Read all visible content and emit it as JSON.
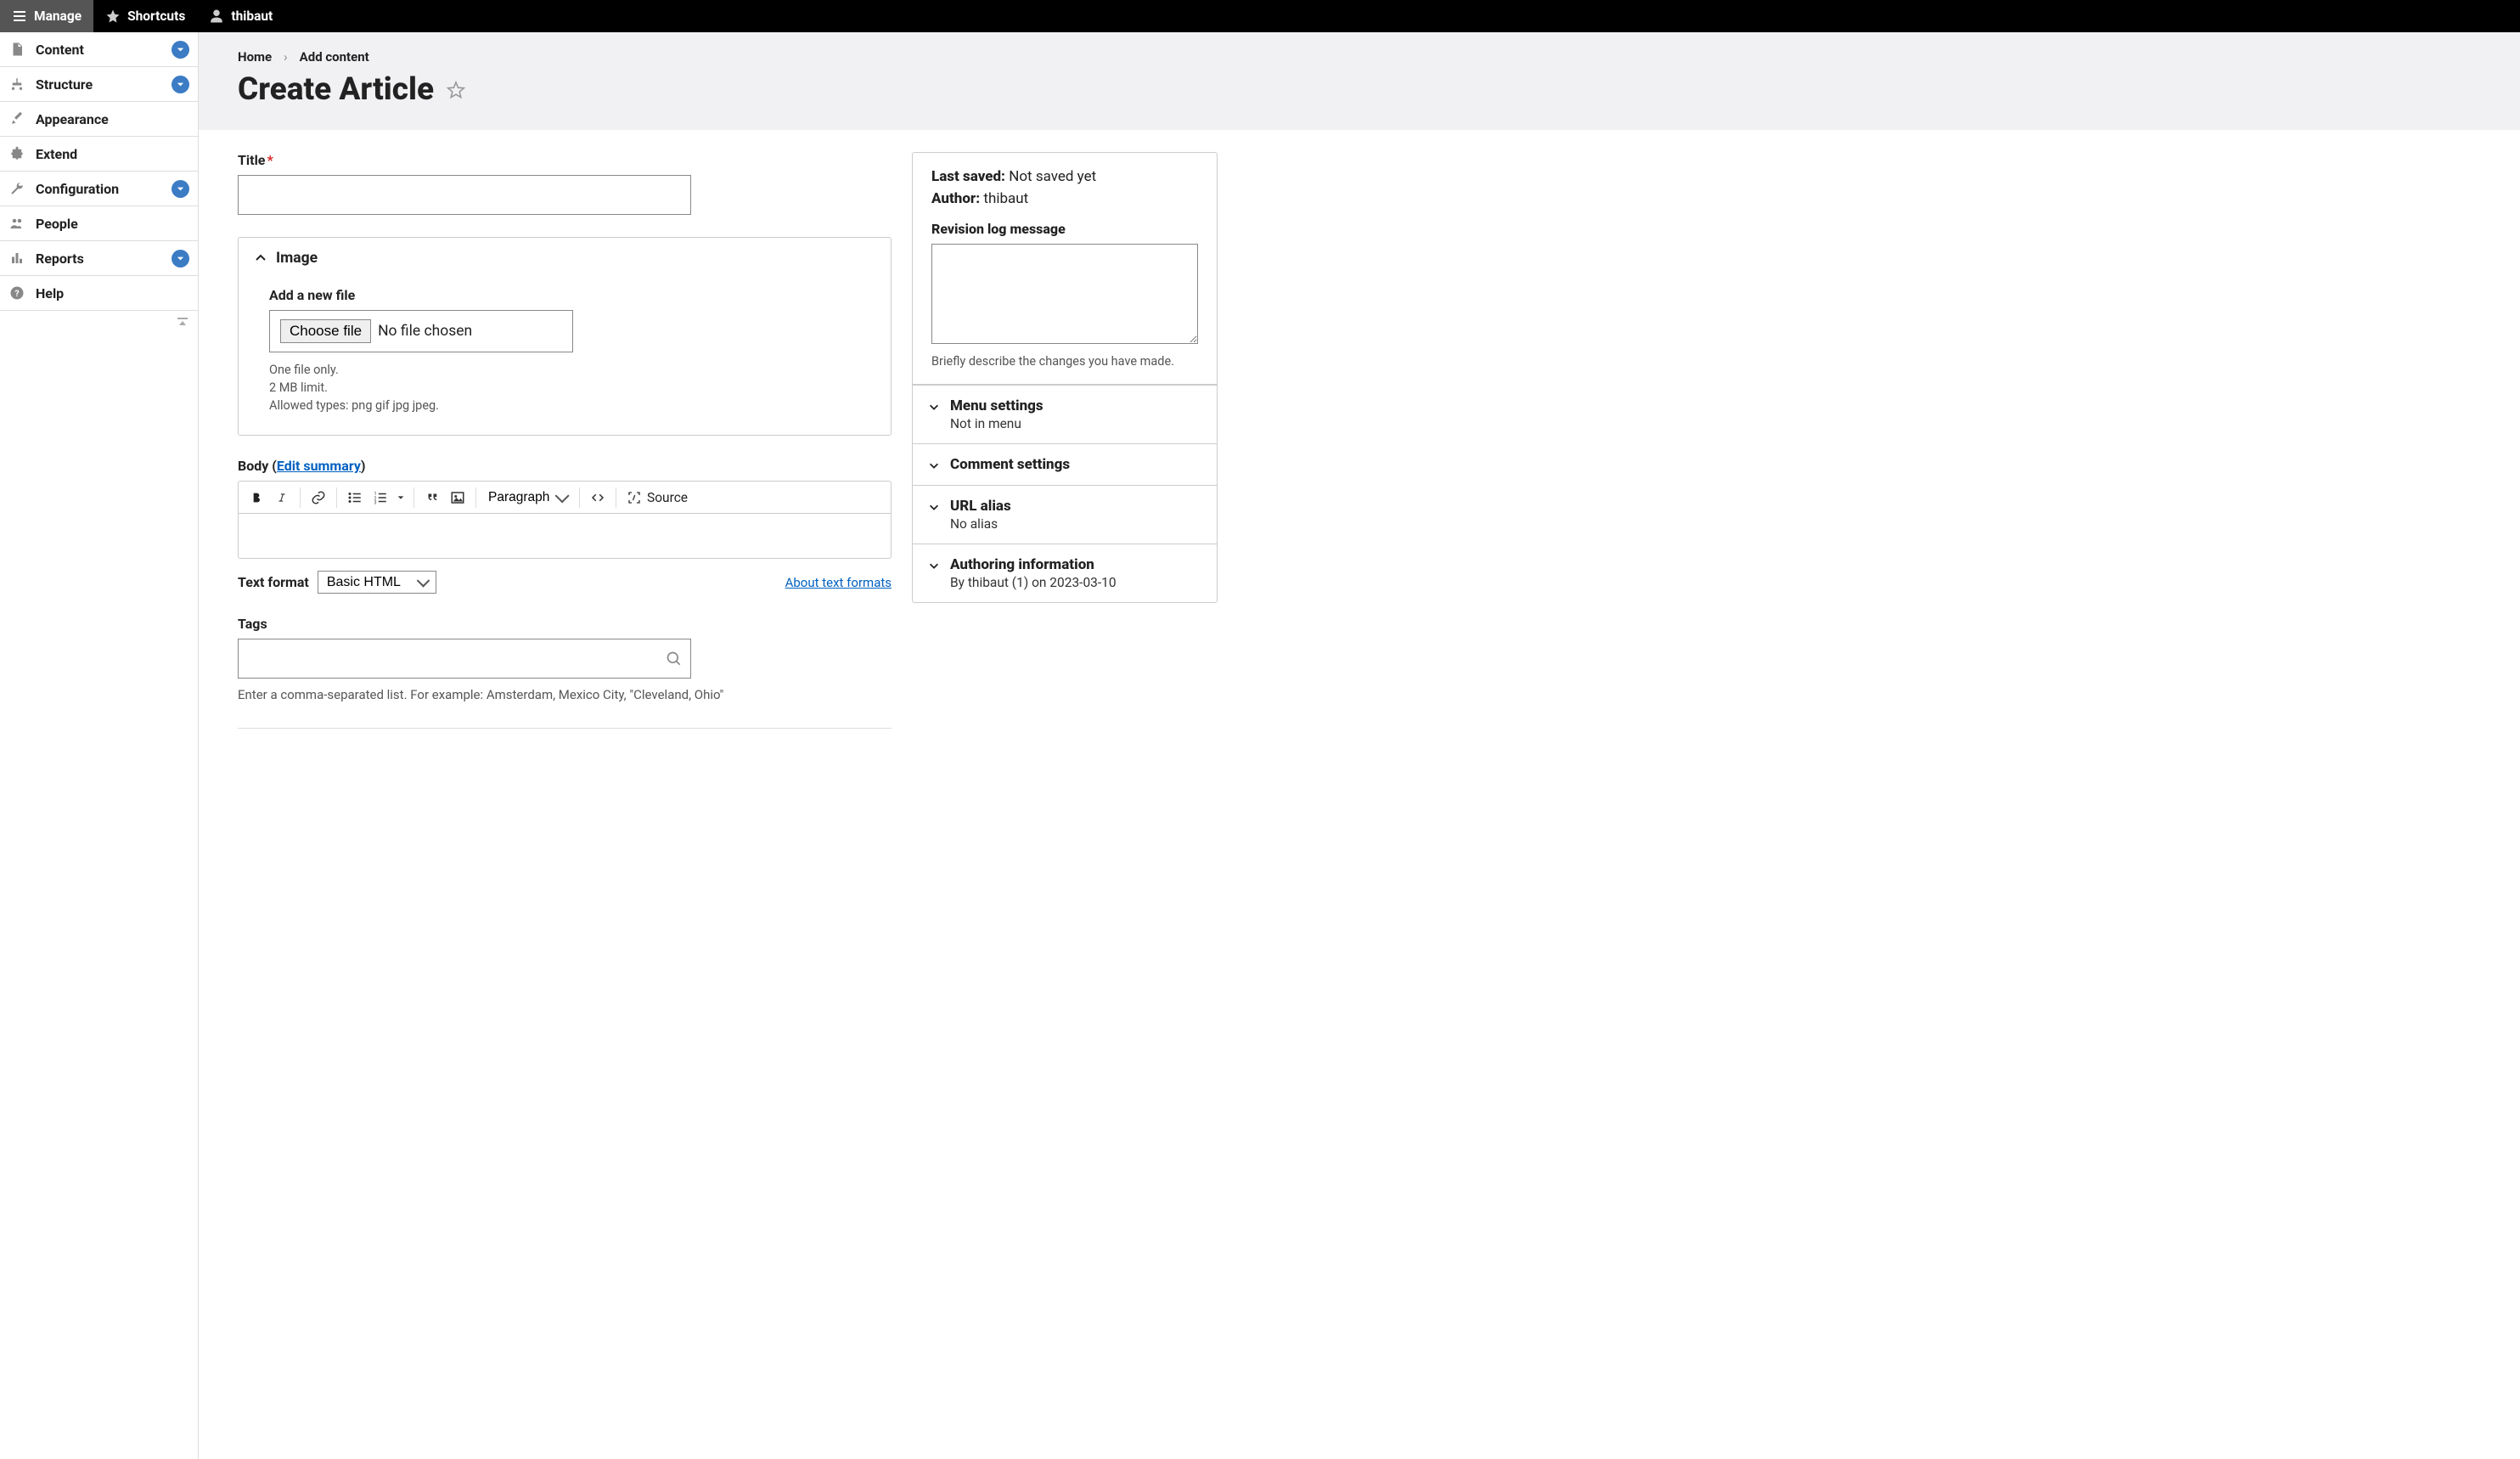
{
  "toolbar": {
    "manage": "Manage",
    "shortcuts": "Shortcuts",
    "user": "thibaut"
  },
  "sidebar": {
    "items": [
      {
        "label": "Content",
        "expandable": true
      },
      {
        "label": "Structure",
        "expandable": true
      },
      {
        "label": "Appearance",
        "expandable": false
      },
      {
        "label": "Extend",
        "expandable": false
      },
      {
        "label": "Configuration",
        "expandable": true
      },
      {
        "label": "People",
        "expandable": false
      },
      {
        "label": "Reports",
        "expandable": true
      },
      {
        "label": "Help",
        "expandable": false
      }
    ]
  },
  "breadcrumb": {
    "home": "Home",
    "add_content": "Add content"
  },
  "page": {
    "title": "Create Article"
  },
  "form": {
    "title_label": "Title",
    "image_legend": "Image",
    "add_file_label": "Add a new file",
    "choose_file_button": "Choose file",
    "no_file_text": "No file chosen",
    "file_help_line1": "One file only.",
    "file_help_line2": "2 MB limit.",
    "file_help_line3": "Allowed types: png gif jpg jpeg.",
    "body_label": "Body",
    "edit_summary": "Edit summary",
    "paragraph_select": "Paragraph",
    "source_label": "Source",
    "text_format_label": "Text format",
    "text_format_value": "Basic HTML",
    "about_formats": "About text formats",
    "tags_label": "Tags",
    "tags_help": "Enter a comma-separated list. For example: Amsterdam, Mexico City, \"Cleveland, Ohio\""
  },
  "side": {
    "last_saved_label": "Last saved:",
    "last_saved_value": "Not saved yet",
    "author_label": "Author:",
    "author_value": "thibaut",
    "revision_label": "Revision log message",
    "revision_help": "Briefly describe the changes you have made.",
    "menu_title": "Menu settings",
    "menu_sub": "Not in menu",
    "comment_title": "Comment settings",
    "url_title": "URL alias",
    "url_sub": "No alias",
    "authoring_title": "Authoring information",
    "authoring_sub": "By thibaut (1) on 2023-03-10"
  }
}
